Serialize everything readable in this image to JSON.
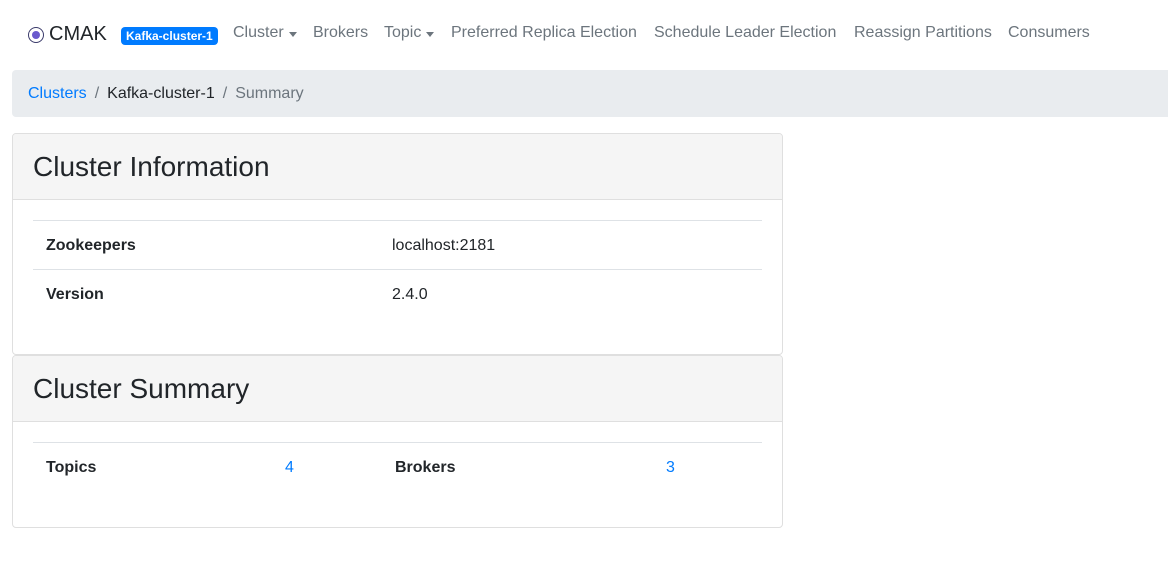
{
  "navbar": {
    "brand": "CMAK",
    "brand_icon": "target-icon",
    "cluster_badge": "Kafka-cluster-1",
    "links": {
      "cluster": "Cluster",
      "brokers": "Brokers",
      "topic": "Topic",
      "preferred_replica_election": "Preferred Replica Election",
      "schedule_leader_election": "Schedule Leader Election",
      "reassign_partitions": "Reassign Partitions",
      "consumers": "Consumers"
    }
  },
  "breadcrumb": {
    "clusters": "Clusters",
    "cluster_name": "Kafka-cluster-1",
    "current": "Summary",
    "separator": "/"
  },
  "cluster_information": {
    "title": "Cluster Information",
    "rows": [
      {
        "label": "Zookeepers",
        "value": "localhost:2181"
      },
      {
        "label": "Version",
        "value": "2.4.0"
      }
    ]
  },
  "cluster_summary": {
    "title": "Cluster Summary",
    "topics_label": "Topics",
    "topics_count": "4",
    "brokers_label": "Brokers",
    "brokers_count": "3"
  },
  "colors": {
    "link": "#007bff",
    "badge_bg": "#007bff",
    "breadcrumb_bg": "#e9ecef",
    "card_header_bg": "#f5f5f5",
    "nav_text": "#6c757d"
  }
}
